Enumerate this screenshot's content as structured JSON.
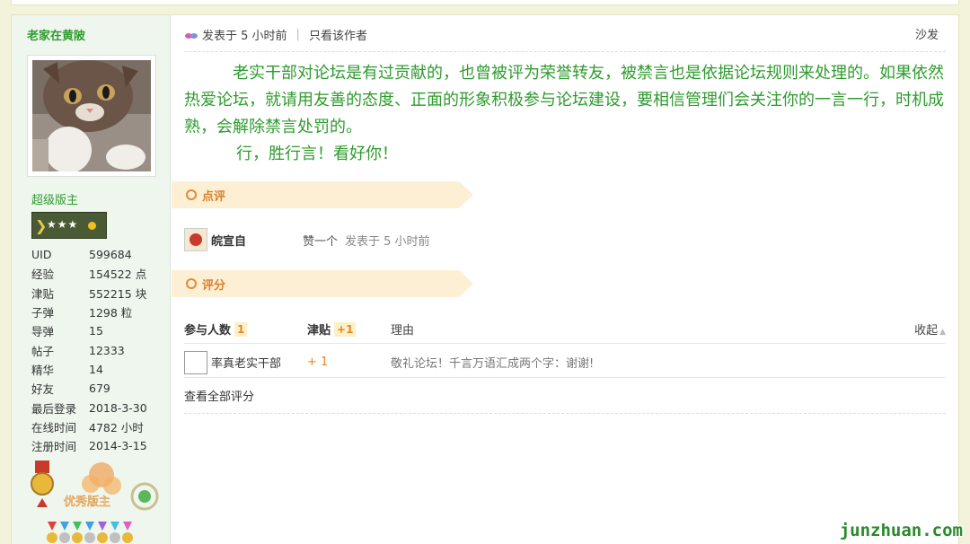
{
  "user": {
    "name": "老家在黄陂",
    "group": "超级版主",
    "stats": [
      {
        "label": "UID",
        "value": "599684"
      },
      {
        "label": "经验",
        "value": "154522 点"
      },
      {
        "label": "津贴",
        "value": "552215 块"
      },
      {
        "label": "子弹",
        "value": "1298 粒"
      },
      {
        "label": "导弹",
        "value": "15"
      },
      {
        "label": "帖子",
        "value": "12333"
      },
      {
        "label": "精华",
        "value": "14"
      },
      {
        "label": "好友",
        "value": "679"
      },
      {
        "label": "最后登录",
        "value": "2018-3-30"
      },
      {
        "label": "在线时间",
        "value": "4782 小时"
      },
      {
        "label": "注册时间",
        "value": "2014-3-15"
      }
    ],
    "medal_text": "优秀版主"
  },
  "post": {
    "posted": "发表于 5 小时前",
    "author_only": "只看该作者",
    "floor": "沙发",
    "paragraph1": "老实干部对论坛是有过贡献的，也曾被评为荣誉转友，被禁言也是依据论坛规则来处理的。如果依然热爱论坛，就请用友善的态度、正面的形象积极参与论坛建设，要相信管理们会关注你的一言一行，时机成熟，会解除禁言处罚的。",
    "paragraph2": "行，胜行言！看好你！"
  },
  "comments_section": {
    "title": "点评",
    "items": [
      {
        "name": "皖宣自",
        "text": "赞一个",
        "time": "发表于 5 小时前"
      }
    ]
  },
  "rating_section": {
    "title": "评分",
    "col_participants": "参与人数",
    "participants_count": "1",
    "col_allowance": "津贴",
    "allowance_total": "+1",
    "col_reason": "理由",
    "collapse": "收起",
    "rows": [
      {
        "name": "率真老实干部",
        "value": "+ 1",
        "reason": "敬礼论坛！千言万语汇成两个字：谢谢!"
      }
    ],
    "view_all": "查看全部评分"
  },
  "watermark": "junzhuan.com",
  "colors": {
    "accent_green": "#2e9b2e",
    "accent_orange": "#e08a2a",
    "section_bg": "#fcefd4"
  }
}
